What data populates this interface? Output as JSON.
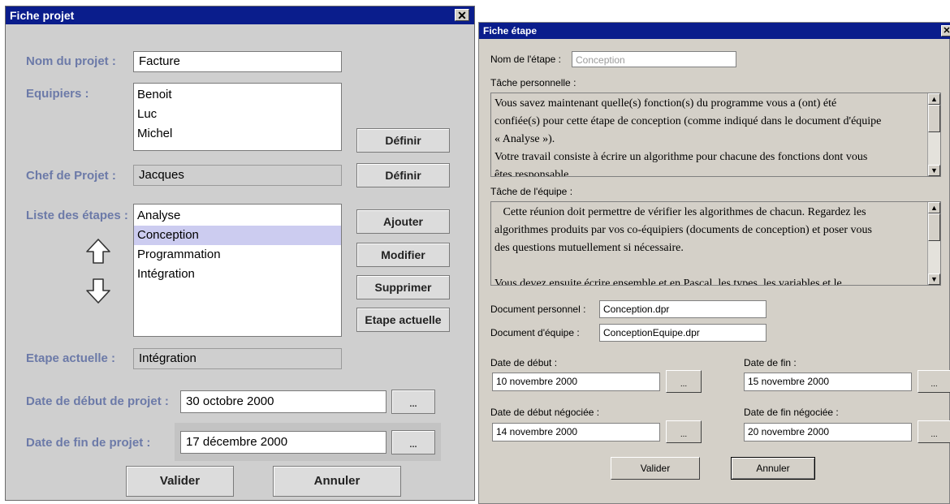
{
  "fiche_projet": {
    "title": "Fiche projet",
    "close_glyph": "✕",
    "labels": {
      "nom": "Nom du projet :",
      "equipiers": "Equipiers :",
      "chef": "Chef de Projet :",
      "etapes": "Liste des étapes :",
      "etape_actuelle": "Etape actuelle :",
      "date_debut": "Date de début de projet :",
      "date_fin": "Date de fin de projet :"
    },
    "nom_projet": "Facture",
    "equipiers": [
      "Benoit",
      "Luc",
      "Michel"
    ],
    "chef": "Jacques",
    "etapes": [
      "Analyse",
      "Conception",
      "Programmation",
      "Intégration"
    ],
    "etape_selected": "Conception",
    "etape_actuelle": "Intégration",
    "date_debut": "30 octobre 2000",
    "date_fin": "17 décembre 2000",
    "buttons": {
      "definir_equipiers": "Définir",
      "definir_chef": "Définir",
      "ajouter": "Ajouter",
      "modifier": "Modifier",
      "supprimer": "Supprimer",
      "etape_actuelle": "Etape actuelle",
      "date_picker": "...",
      "valider": "Valider",
      "annuler": "Annuler"
    },
    "icons": {
      "move_up": "arrow-up-outline-icon",
      "move_down": "arrow-down-outline-icon"
    }
  },
  "fiche_etape": {
    "title": "Fiche étape",
    "close_glyph": "✕",
    "labels": {
      "nom": "Nom de l'étape :",
      "tache_perso": "Tâche personnelle :",
      "tache_equipe": "Tâche de l'équipe :",
      "doc_perso": "Document personnel :",
      "doc_equipe": "Document d'équipe :",
      "date_debut": "Date de début :",
      "date_fin": "Date de fin :",
      "date_debut_neg": "Date de début négociée :",
      "date_fin_neg": "Date de fin négociée :"
    },
    "nom_etape": "Conception",
    "tache_personnelle": [
      "Vous savez maintenant  quelle(s) fonction(s) du programme vous a (ont) été",
      "confiée(s) pour cette étape de conception (comme indiqué dans le document d'équipe",
      "« Analyse »).",
      "Votre travail consiste à écrire un algorithme pour chacune des fonctions dont vous",
      "êtes responsable"
    ],
    "tache_equipe": [
      "   Cette réunion doit permettre de vérifier les algorithmes de chacun. Regardez les",
      "algorithmes produits par vos co-équipiers (documents de conception) et poser vous",
      "des questions mutuellement si nécessaire.",
      "",
      "Vous devez ensuite écrire ensemble et en Pascal, les types, les variables et le"
    ],
    "doc_personnel": "Conception.dpr",
    "doc_equipe": "ConceptionEquipe.dpr",
    "date_debut": "10 novembre 2000",
    "date_fin": "15 novembre 2000",
    "date_debut_negociee": "14 novembre 2000",
    "date_fin_negociee": "20 novembre 2000",
    "buttons": {
      "date_picker": "...",
      "valider": "Valider",
      "annuler": "Annuler"
    },
    "scroll_glyphs": {
      "up": "▲",
      "down": "▼"
    }
  }
}
